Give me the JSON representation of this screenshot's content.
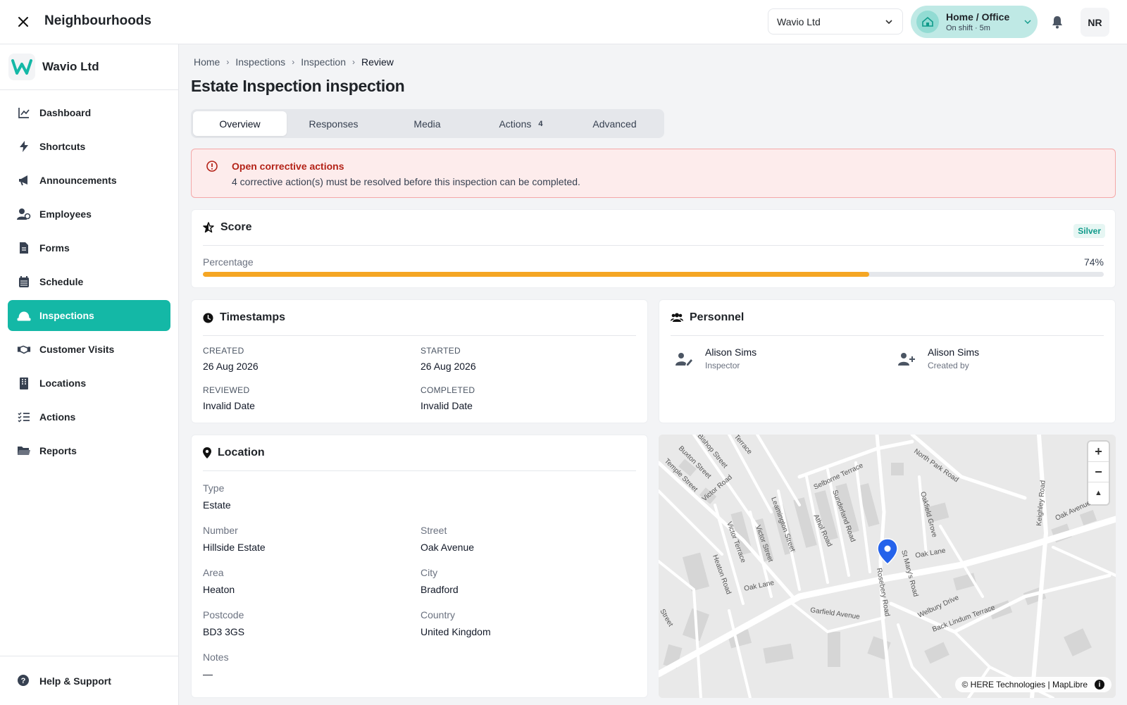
{
  "header": {
    "app_title": "Neighbourhoods",
    "org_selected": "Wavio Ltd",
    "shift_title": "Home / Office",
    "shift_status": "On shift · 5m",
    "avatar_initials": "NR"
  },
  "sidebar": {
    "brand_name": "Wavio Ltd",
    "items": [
      {
        "label": "Dashboard",
        "icon": "chart-line-icon"
      },
      {
        "label": "Shortcuts",
        "icon": "bolt-icon"
      },
      {
        "label": "Announcements",
        "icon": "megaphone-icon"
      },
      {
        "label": "Employees",
        "icon": "users-icon"
      },
      {
        "label": "Forms",
        "icon": "file-icon"
      },
      {
        "label": "Schedule",
        "icon": "calendar-icon"
      },
      {
        "label": "Inspections",
        "icon": "hard-hat-icon",
        "active": true
      },
      {
        "label": "Customer Visits",
        "icon": "handshake-icon"
      },
      {
        "label": "Locations",
        "icon": "building-icon"
      },
      {
        "label": "Actions",
        "icon": "list-check-icon"
      },
      {
        "label": "Reports",
        "icon": "folder-icon"
      }
    ],
    "help_label": "Help & Support"
  },
  "breadcrumb": [
    "Home",
    "Inspections",
    "Inspection",
    "Review"
  ],
  "page_title": "Estate Inspection inspection",
  "tabs": [
    {
      "label": "Overview",
      "active": true
    },
    {
      "label": "Responses"
    },
    {
      "label": "Media"
    },
    {
      "label": "Actions",
      "badge": "4"
    },
    {
      "label": "Advanced"
    }
  ],
  "alert": {
    "title": "Open corrective actions",
    "message": "4 corrective action(s) must be resolved before this inspection can be completed."
  },
  "score": {
    "title": "Score",
    "tier": "Silver",
    "percentage_label": "Percentage",
    "percentage_text": "74%",
    "percentage": 74
  },
  "timestamps": {
    "title": "Timestamps",
    "created_label": "CREATED",
    "created": "26 Aug 2026",
    "started_label": "STARTED",
    "started": "26 Aug 2026",
    "reviewed_label": "REVIEWED",
    "reviewed": "Invalid Date",
    "completed_label": "COMPLETED",
    "completed": "Invalid Date"
  },
  "personnel": {
    "title": "Personnel",
    "inspector_name": "Alison Sims",
    "inspector_role": "Inspector",
    "creator_name": "Alison Sims",
    "creator_role": "Created by"
  },
  "location": {
    "title": "Location",
    "type_label": "Type",
    "type": "Estate",
    "number_label": "Number",
    "number": "Hillside Estate",
    "street_label": "Street",
    "street": "Oak Avenue",
    "area_label": "Area",
    "area": "Heaton",
    "city_label": "City",
    "city": "Bradford",
    "postcode_label": "Postcode",
    "postcode": "BD3 3GS",
    "country_label": "Country",
    "country": "United Kingdom",
    "notes_label": "Notes",
    "notes": "—"
  },
  "map": {
    "zoom_in": "+",
    "zoom_out": "−",
    "compass": "▲",
    "attribution": "© HERE Technologies | MapLibre",
    "info": "i",
    "street_labels": [
      "Oak Lane",
      "Oak Lane",
      "Garfield Avenue",
      "Rosebery Road",
      "St Mary's Road",
      "Welbury Drive",
      "Back Lindum Terrace",
      "Oakfield Grove",
      "North Park Road",
      "Selborne Terrace",
      "Sunderland Road",
      "Athol Road",
      "Leamington Street",
      "Victor Street",
      "Victor Terrace",
      "Heaton Road",
      "Victor Road",
      "Temple Street",
      "Buxton Street",
      "Bishop Street",
      "Terrace",
      "Keighley Road",
      "Oak Avenue",
      "Street"
    ]
  },
  "colors": {
    "accent": "#14b8a6",
    "progress": "#f5a623",
    "alert_text": "#b42318",
    "pin": "#2563eb"
  }
}
